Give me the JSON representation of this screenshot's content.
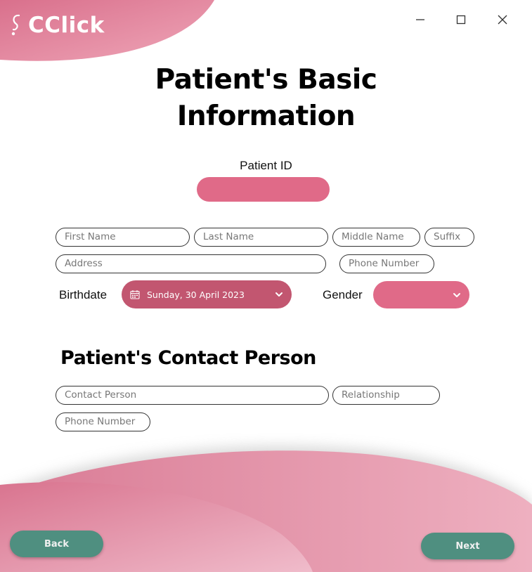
{
  "app": {
    "name": "CClick"
  },
  "window_controls": {
    "minimize": "minimize-icon",
    "maximize": "maximize-icon",
    "close": "close-icon"
  },
  "title": {
    "line1": "Patient's Basic",
    "line2": "Information"
  },
  "patient_id": {
    "label": "Patient ID",
    "value": ""
  },
  "basic_fields": {
    "first_name": "First Name",
    "last_name": "Last Name",
    "middle_name": "Middle Name",
    "suffix": "Suffix",
    "address": "Address",
    "phone": "Phone Number"
  },
  "birthdate": {
    "label": "Birthdate",
    "value": "Sunday, 30 April 2023",
    "icon": "calendar-icon"
  },
  "gender": {
    "label": "Gender",
    "value": ""
  },
  "contact_section": {
    "heading": "Patient's Contact Person",
    "contact_person": "Contact Person",
    "relationship": "Relationship",
    "phone": "Phone Number"
  },
  "nav": {
    "back": "Back",
    "next": "Next"
  },
  "colors": {
    "pink": "#e06a88",
    "dark_pink": "#c25670",
    "teal": "#4f8f80",
    "wave": "#e38aa2"
  }
}
